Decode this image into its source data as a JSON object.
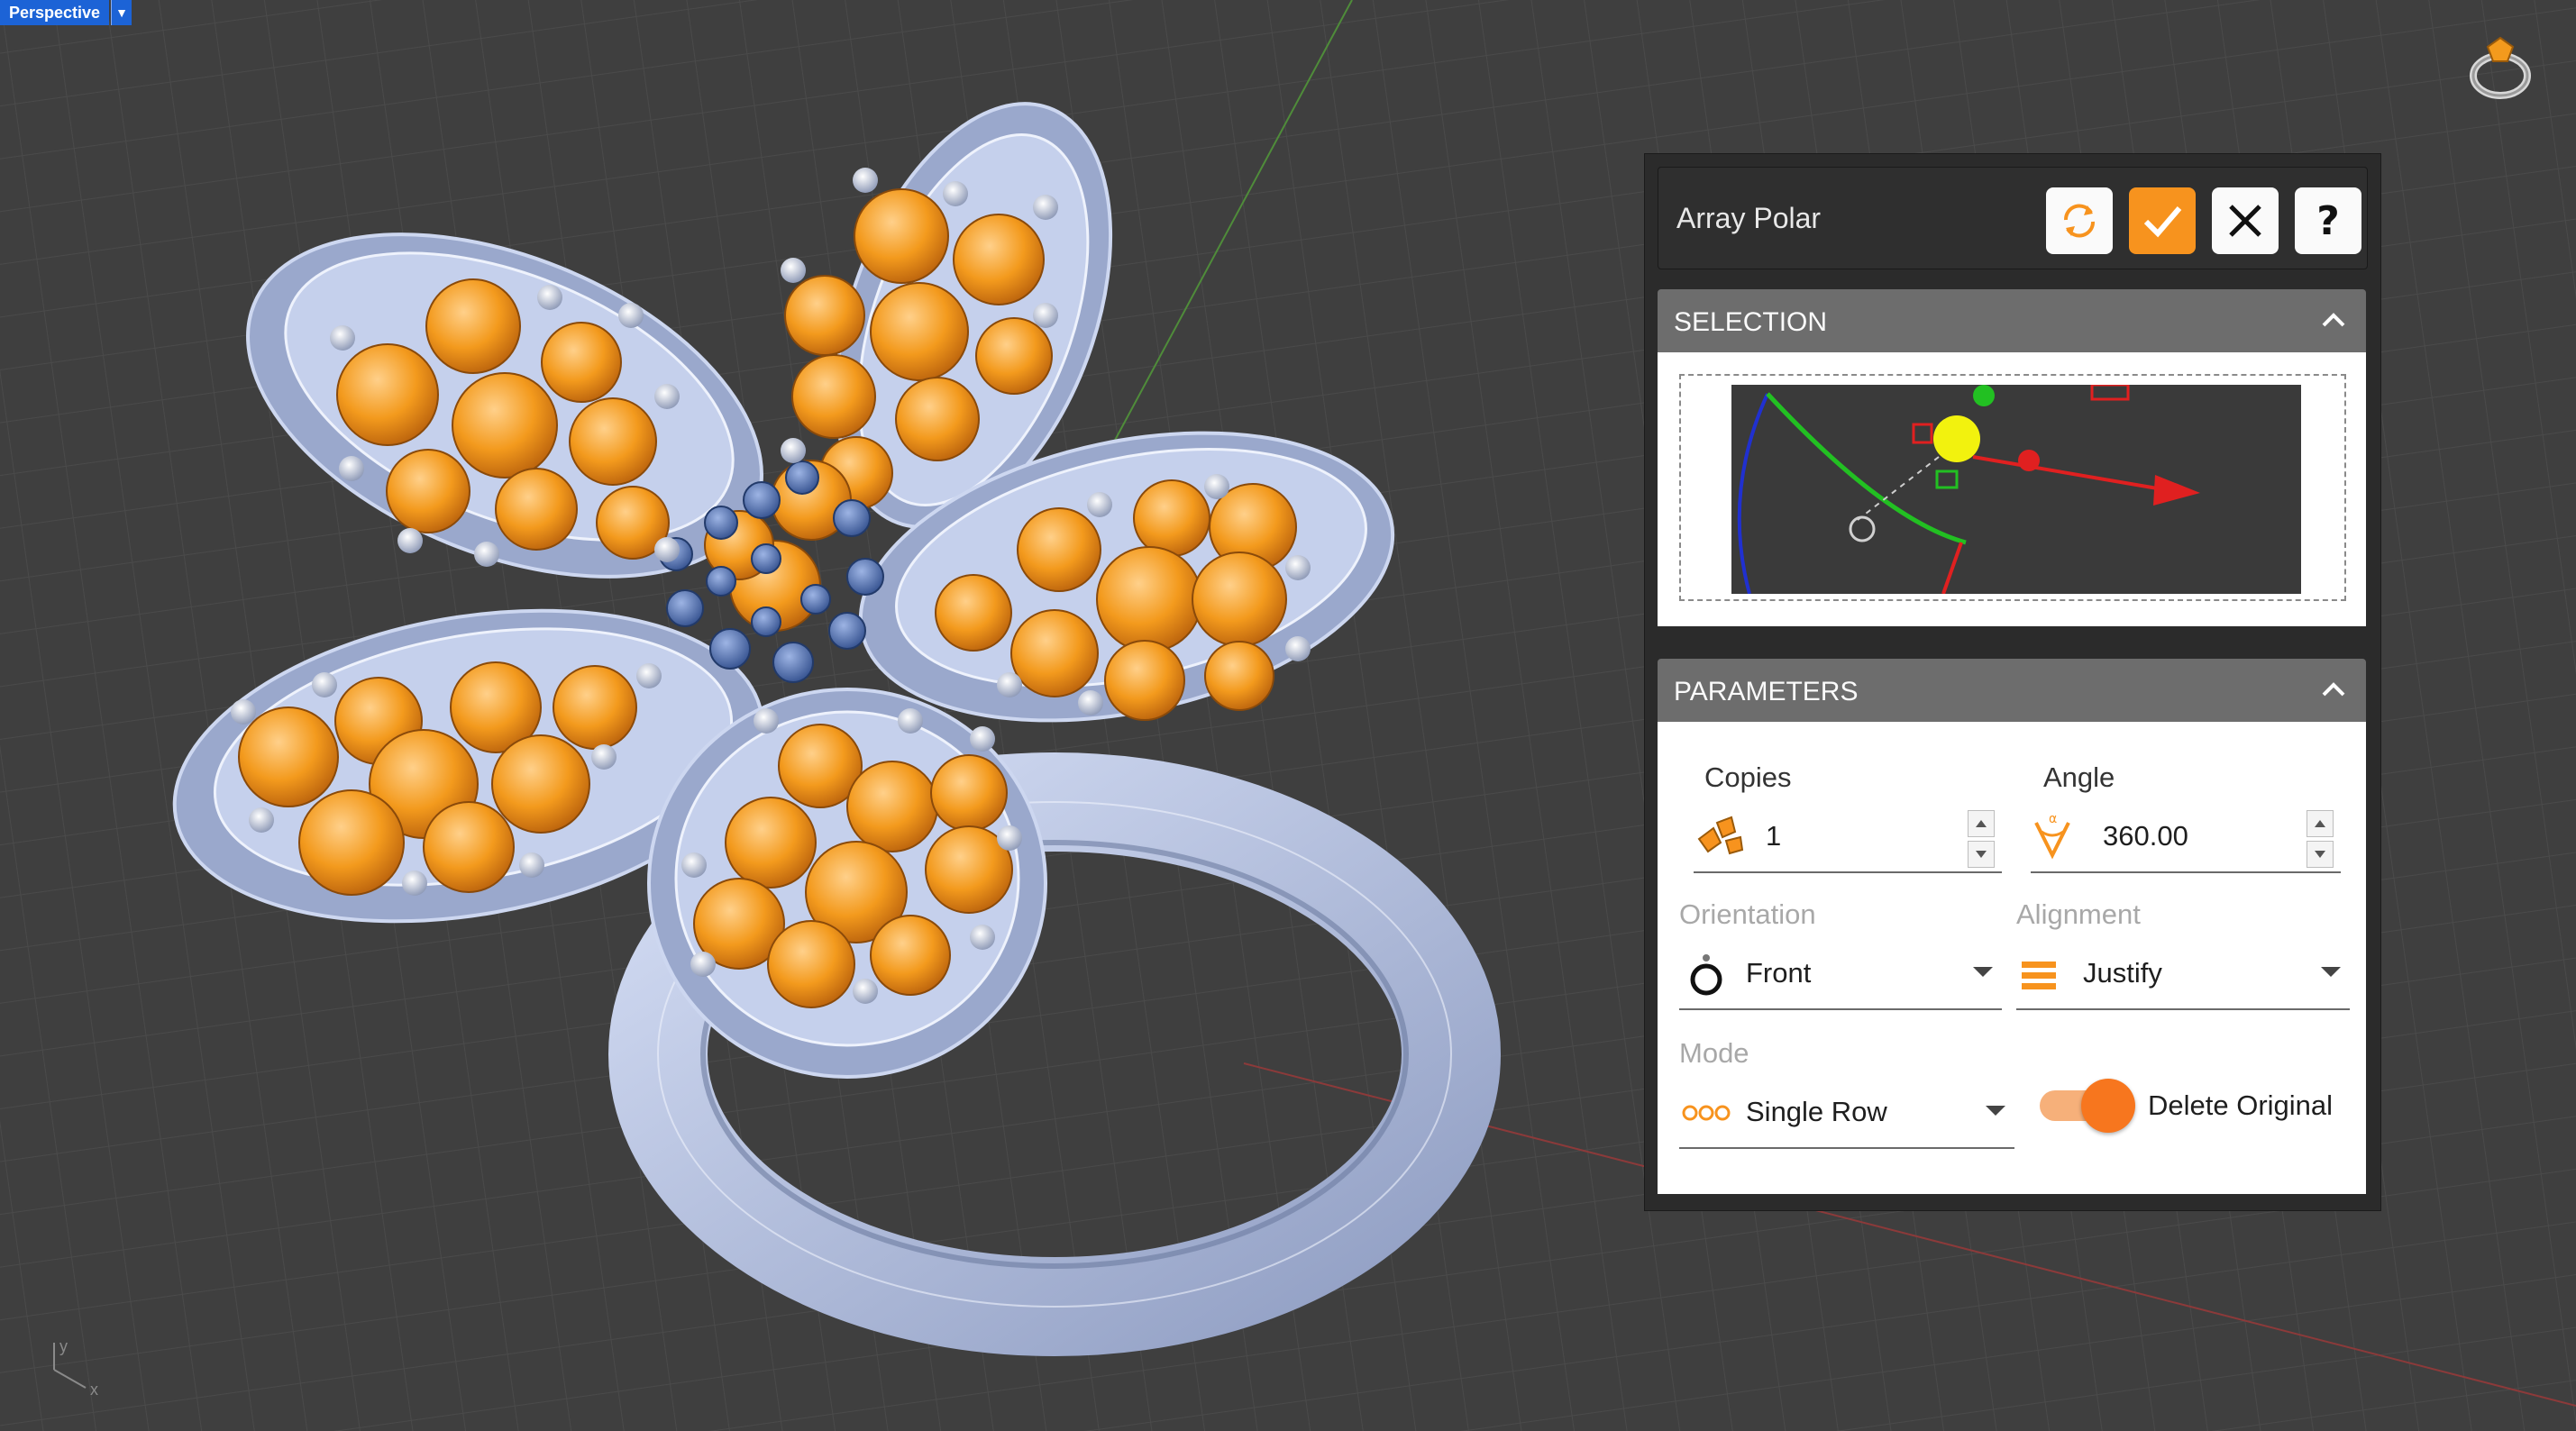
{
  "viewport": {
    "label": "Perspective",
    "dropdown_icon": "triangle-down-icon",
    "logo_icon": "ring-logo-icon",
    "axis_icon": "xyz-axis-icon",
    "axis_labels": {
      "x": "x",
      "y": "y"
    }
  },
  "panel": {
    "title": "Array Polar",
    "buttons": [
      {
        "name": "refresh",
        "icon": "refresh-icon"
      },
      {
        "name": "confirm",
        "icon": "checkmark-icon",
        "color": "#f7931e"
      },
      {
        "name": "cancel",
        "icon": "close-icon"
      },
      {
        "name": "help",
        "icon": "question-icon",
        "label": "?"
      }
    ],
    "selection": {
      "header": "SELECTION"
    },
    "parameters": {
      "header": "PARAMETERS",
      "copies": {
        "label": "Copies",
        "value": "1",
        "icon": "gems-copies-icon"
      },
      "angle": {
        "label": "Angle",
        "value": "360.00",
        "icon": "angle-icon"
      },
      "orientation": {
        "label": "Orientation",
        "value": "Front",
        "icon": "ring-front-icon"
      },
      "alignment": {
        "label": "Alignment",
        "value": "Justify",
        "icon": "justify-icon"
      },
      "mode": {
        "label": "Mode",
        "value": "Single Row",
        "icon": "single-row-icon"
      },
      "delete_original": {
        "label": "Delete Original",
        "enabled": true
      }
    }
  },
  "colors": {
    "accent": "#f7931e",
    "viewport_bg": "#3f3f3f",
    "panel_header": "#6d6d6d",
    "gem_orange": "#f39a1d",
    "metal": "#aab8dc"
  }
}
